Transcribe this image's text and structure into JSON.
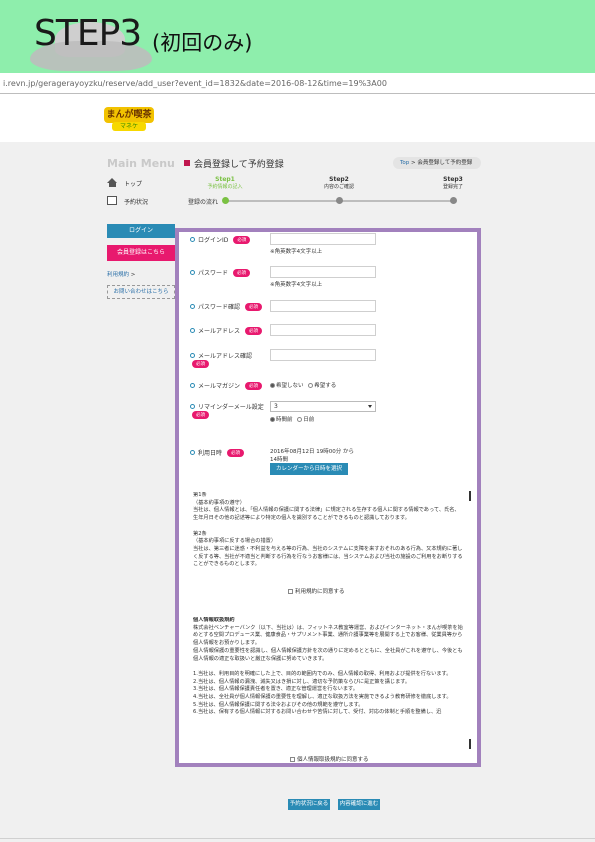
{
  "banner": {
    "title": "STEP3",
    "subtitle": "(初回のみ)"
  },
  "browser": {
    "url": "i.revn.jp/geragerayoyzku/reserve/add_user?event_id=1832&date=2016-08-12&time=19%3A00"
  },
  "logo": {
    "line1": "まんが喫茶",
    "line2": "マネケ"
  },
  "sidebar": {
    "title": "Main Menu",
    "items": [
      {
        "label": "トップ",
        "icon": "home-icon"
      },
      {
        "label": "予約状況",
        "icon": "book-icon"
      }
    ],
    "login_label": "ログイン",
    "register_label": "会員登録はこちら",
    "terms_label": "利用規約",
    "contact_label": "お問い合わせはこちら"
  },
  "header": {
    "title": "会員登録して予約登録",
    "breadcrumb_top": "Top",
    "breadcrumb_current": "会員登録して予約登録"
  },
  "steps": {
    "flow_label": "登録の流れ",
    "items": [
      {
        "label": "Step1",
        "desc": "予約情報の記入"
      },
      {
        "label": "Step2",
        "desc": "内容のご確認"
      },
      {
        "label": "Step3",
        "desc": "登録完了"
      }
    ]
  },
  "form": {
    "required": "必須",
    "login_id": {
      "label": "ログインID",
      "hint": "※角英数字4文字以上"
    },
    "password": {
      "label": "パスワード",
      "hint": "※角英数字4文字以上"
    },
    "password_confirm": {
      "label": "パスワード確認"
    },
    "email": {
      "label": "メールアドレス"
    },
    "email_confirm": {
      "label": "メールアドレス確認"
    },
    "magazine": {
      "label": "メールマガジン",
      "options": [
        "希望しない",
        "希望する"
      ]
    },
    "reminder": {
      "label": "リマインダーメール設定",
      "selected": "3",
      "options": [
        "時間前",
        "日前"
      ]
    },
    "date": {
      "label": "利用日時",
      "value": "2016年08月12日 19時00分 から",
      "duration": "14時間",
      "calendar_button": "カレンダーから日時を選択"
    }
  },
  "terms": {
    "text": [
      "第1条",
      "（基本約事項の遵守）",
      "当社は、個人情報とは、「個人情報の保護に関する法律」に規定される生存する個人に関する情報であって、氏名、生年月日その他の記述等により特定の個人を識別することができるものと認識しております。",
      "",
      "第2条",
      "（基本約事項に反する場合の措置）",
      "当社は、第三者に迷惑・不利益を与える等の行為、当社のシステムに支障を来すおそれのある行為、又本規約に著しく反する等、当社が不適当と判断する行為を行なうお客様には、当システムおよび当社の施設のご利用をお断りすることができるものとします。"
    ],
    "agree": "利用規約に同意する"
  },
  "privacy": {
    "heading": "個人情報取扱規約",
    "text": [
      "株式会社ベンチャーバンク（以下、当社は）は、フィットネス教室等運営、およびインターネット・まんが喫茶を始めとする空間プロデュース業、健康食品・サプリメント事業、通所介護事業等を展開する上でお客様、従業員等から個人情報をお預かりします。",
      "個人情報保護の重要性を認識し、個人情報保護方針を次の通りに定めるとともに、全社員がこれを遵守し、今後とも個人情報の適正な取扱いと厳正な保護に努めていきます。",
      "",
      "1.当社は、利用目的を明確にした上で、目的の範囲内でのみ、個人情報の取得、利用および提供を行ないます。",
      "2.当社は、個人情報の漏洩、滅失又はき損に対し、適切な予防策ならびに是正策を講じます。",
      "3.当社は、個人情報保護責任者を置き、適正な管理運営を行ないます。",
      "4.当社は、全社員が個人情報保護の重要性を理解し、適正な取扱方法を実施できるよう教育研修を徹底します。",
      "5.当社は、個人情報保護に関する法令およびその他の規範を遵守します。",
      "6.当社は、保有する個人情報に対するお問い合わせや苦情に対して、受付、対応の体制と手順を整備し、迅"
    ],
    "agree": "個人情報取扱規約に同意する"
  },
  "buttons": {
    "back": "予約状況に戻る",
    "confirm": "内容確認に進む"
  },
  "colors": {
    "banner": "#8eeeac",
    "frame": "#a281bd",
    "accent": "#2a8bb5",
    "required": "#e8196e",
    "step_active": "#7ac142"
  }
}
